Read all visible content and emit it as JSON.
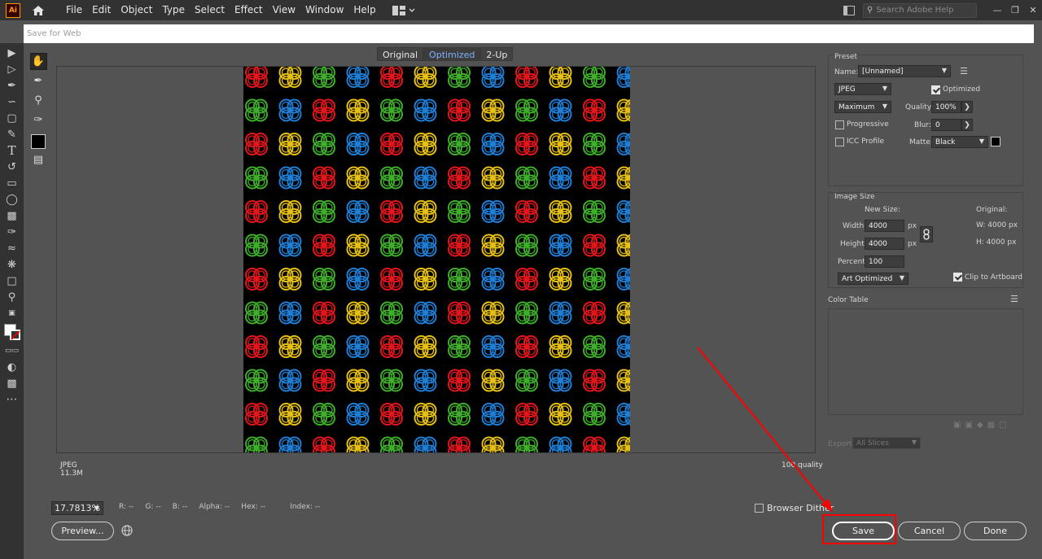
{
  "app": {
    "logo": "Ai",
    "menu": [
      "File",
      "Edit",
      "Object",
      "Type",
      "Select",
      "Effect",
      "View",
      "Window",
      "Help"
    ],
    "search_placeholder": "Search Adobe Help"
  },
  "dialog": {
    "title": "Save for Web",
    "tabs": [
      "Original",
      "Optimized",
      "2-Up"
    ],
    "active_tab": "Optimized",
    "info_format": "JPEG",
    "info_size": "11.3M",
    "info_quality": "100 quality",
    "zoom": "17.7813%",
    "readouts": {
      "r": "R: --",
      "g": "G: --",
      "b": "B: --",
      "alpha": "Alpha: --",
      "hex": "Hex: --",
      "index": "Index: --"
    },
    "browser_dither": "Browser Dither",
    "preview_label": "Preview...",
    "save_label": "Save",
    "cancel_label": "Cancel",
    "done_label": "Done"
  },
  "preset": {
    "title": "Preset",
    "name_label": "Name:",
    "name_value": "[Unnamed]",
    "format": "JPEG",
    "optimized_label": "Optimized",
    "compression": "Maximum",
    "quality_label": "Quality:",
    "quality_value": "100%",
    "progressive_label": "Progressive",
    "blur_label": "Blur:",
    "blur_value": "0",
    "icc_label": "ICC Profile",
    "matte_label": "Matte:",
    "matte_value": "Black"
  },
  "image_size": {
    "title": "Image Size",
    "new_size_label": "New Size:",
    "original_label": "Original:",
    "width_label": "Width:",
    "width_value": "4000",
    "height_label": "Height:",
    "height_value": "4000",
    "percent_label": "Percent:",
    "percent_value": "100",
    "px1": "px",
    "px2": "px",
    "orig_w": "W:  4000 px",
    "orig_h": "H:  4000 px",
    "quality_method": "Art Optimized",
    "clip_label": "Clip to Artboard"
  },
  "color_table": {
    "title": "Color Table"
  },
  "export": {
    "label": "Export:",
    "value": "All Slices"
  },
  "colors": {
    "red": "#e3161b",
    "yellow": "#e6c013",
    "green": "#3fae2a",
    "blue": "#1f7fd6",
    "annotation": "#ff0000"
  }
}
